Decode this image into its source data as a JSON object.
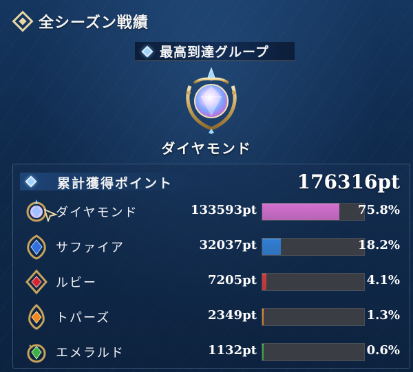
{
  "header": {
    "title": "全シーズン戦績"
  },
  "highest_group": {
    "label": "最高到達グループ",
    "rank_name": "ダイヤモンド"
  },
  "points": {
    "label": "累計獲得ポイント",
    "total": "176316pt",
    "rows": [
      {
        "name": "ダイヤモンド",
        "points": "133593pt",
        "percent": "75.8%",
        "fraction": 0.758,
        "color": "#d46fd0",
        "icon": "diamond-gem-icon"
      },
      {
        "name": "サファイア",
        "points": "32037pt",
        "percent": "18.2%",
        "fraction": 0.182,
        "color": "#2f7fd6",
        "icon": "sapphire-gem-icon"
      },
      {
        "name": "ルビー",
        "points": "7205pt",
        "percent": "4.1%",
        "fraction": 0.041,
        "color": "#d03a3a",
        "icon": "ruby-gem-icon"
      },
      {
        "name": "トパーズ",
        "points": "2349pt",
        "percent": "1.3%",
        "fraction": 0.013,
        "color": "#e08a2c",
        "icon": "topaz-gem-icon"
      },
      {
        "name": "エメラルド",
        "points": "1132pt",
        "percent": "0.6%",
        "fraction": 0.006,
        "color": "#3fae4a",
        "icon": "emerald-gem-icon"
      }
    ]
  }
}
